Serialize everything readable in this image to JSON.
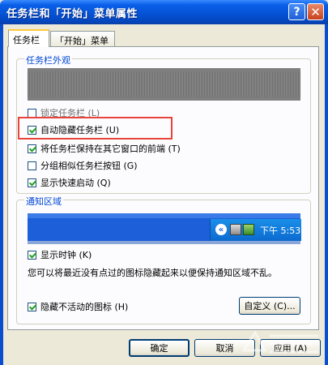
{
  "window": {
    "title": "任务栏和「开始」菜单属性",
    "help_glyph": "?",
    "close_glyph": "✕"
  },
  "tabs": [
    {
      "label": "任务栏",
      "selected": true
    },
    {
      "label": "「开始」菜单",
      "selected": false
    }
  ],
  "appearance": {
    "legend": "任务栏外观",
    "options": [
      {
        "label": "锁定任务栏 (L)",
        "checked": false
      },
      {
        "label": "自动隐藏任务栏 (U)",
        "checked": true
      },
      {
        "label": "将任务栏保持在其它窗口的前端 (T)",
        "checked": true
      },
      {
        "label": "分组相似任务栏按钮 (G)",
        "checked": false
      },
      {
        "label": "显示快速启动 (Q)",
        "checked": true
      }
    ]
  },
  "notification": {
    "legend": "通知区域",
    "tray_clock": "下午 5:53",
    "show_clock": {
      "label": "显示时钟 (K)",
      "checked": true
    },
    "description": "您可以将最近没有点过的图标隐藏起来以便保持通知区域不乱。",
    "hide_inactive": {
      "label": "隐藏不活动的图标 (H)",
      "checked": true
    },
    "customize_label": "自定义 (C)..."
  },
  "buttons": {
    "ok": "确定",
    "cancel": "取消",
    "apply": "应用 (A)"
  },
  "colors": {
    "title_bar": "#0553d6",
    "highlight": "#e8443a",
    "legend_text": "#0046d5"
  }
}
